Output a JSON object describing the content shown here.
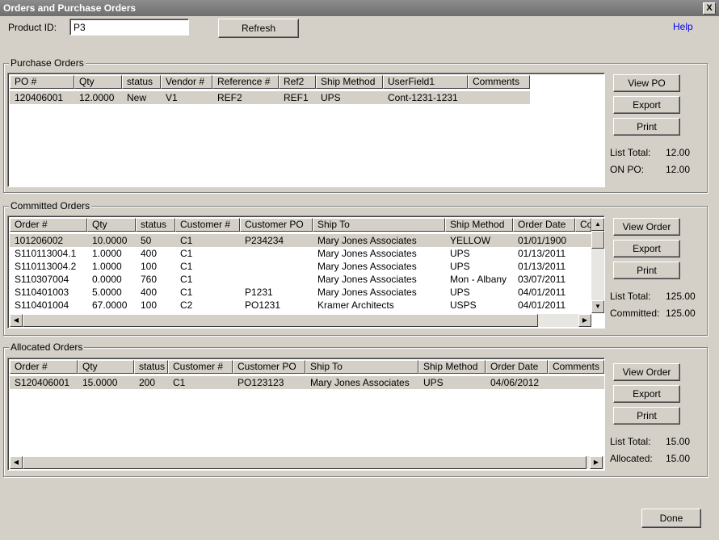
{
  "window": {
    "title": "Orders and Purchase Orders",
    "close_symbol": "X"
  },
  "top": {
    "product_label": "Product ID:",
    "product_value": "P3",
    "refresh_label": "Refresh",
    "help_label": "Help"
  },
  "purchase": {
    "legend": "Purchase Orders",
    "columns": [
      "PO #",
      "Qty",
      "status",
      "Vendor #",
      "Reference #",
      "Ref2",
      "Ship Method",
      "UserField1",
      "Comments"
    ],
    "rows": [
      [
        "120406001",
        "12.0000",
        "New",
        "V1",
        "REF2",
        "REF1",
        "UPS",
        "Cont-1231-1231",
        ""
      ]
    ],
    "buttons": [
      "View PO",
      "Export",
      "Print"
    ],
    "totals": {
      "list_label": "List Total:",
      "list_value": "12.00",
      "second_label": "ON PO:",
      "second_value": "12.00"
    }
  },
  "committed": {
    "legend": "Committed Orders",
    "columns": [
      "Order #",
      "Qty",
      "status",
      "Customer #",
      "Customer PO",
      "Ship To",
      "Ship Method",
      "Order Date",
      "Co"
    ],
    "rows": [
      [
        "101206002",
        "10.0000",
        "50",
        "C1",
        "P234234",
        "Mary Jones Associates",
        "YELLOW",
        "01/01/1900"
      ],
      [
        "S110113004.1",
        "1.0000",
        "400",
        "C1",
        "",
        "Mary Jones Associates",
        "UPS",
        "01/13/2011"
      ],
      [
        "S110113004.2",
        "1.0000",
        "100",
        "C1",
        "",
        "Mary Jones Associates",
        "UPS",
        "01/13/2011"
      ],
      [
        "S110307004",
        "0.0000",
        "760",
        "C1",
        "",
        "Mary Jones Associates",
        "Mon - Albany",
        "03/07/2011"
      ],
      [
        "S110401003",
        "5.0000",
        "400",
        "C1",
        "P1231",
        "Mary Jones Associates",
        "UPS",
        "04/01/2011"
      ],
      [
        "S110401004",
        "67.0000",
        "100",
        "C2",
        "PO1231",
        "Kramer Architects",
        "USPS",
        "04/01/2011"
      ]
    ],
    "buttons": [
      "View Order",
      "Export",
      "Print"
    ],
    "totals": {
      "list_label": "List Total:",
      "list_value": "125.00",
      "second_label": "Committed:",
      "second_value": "125.00"
    }
  },
  "allocated": {
    "legend": "Allocated Orders",
    "columns": [
      "Order #",
      "Qty",
      "status",
      "Customer #",
      "Customer PO",
      "Ship To",
      "Ship Method",
      "Order Date",
      "Comments"
    ],
    "rows": [
      [
        "S120406001",
        "15.0000",
        "200",
        "C1",
        "PO123123",
        "Mary Jones Associates",
        "UPS",
        "04/06/2012",
        ""
      ]
    ],
    "buttons": [
      "View Order",
      "Export",
      "Print"
    ],
    "totals": {
      "list_label": "List Total:",
      "list_value": "15.00",
      "second_label": "Allocated:",
      "second_value": "15.00"
    }
  },
  "footer": {
    "done_label": "Done"
  },
  "icons": {
    "scroll_left": "scroll-left-arrow-icon",
    "scroll_right": "scroll-right-arrow-icon",
    "scroll_up": "scroll-up-arrow-icon",
    "scroll_down": "scroll-down-arrow-icon"
  }
}
